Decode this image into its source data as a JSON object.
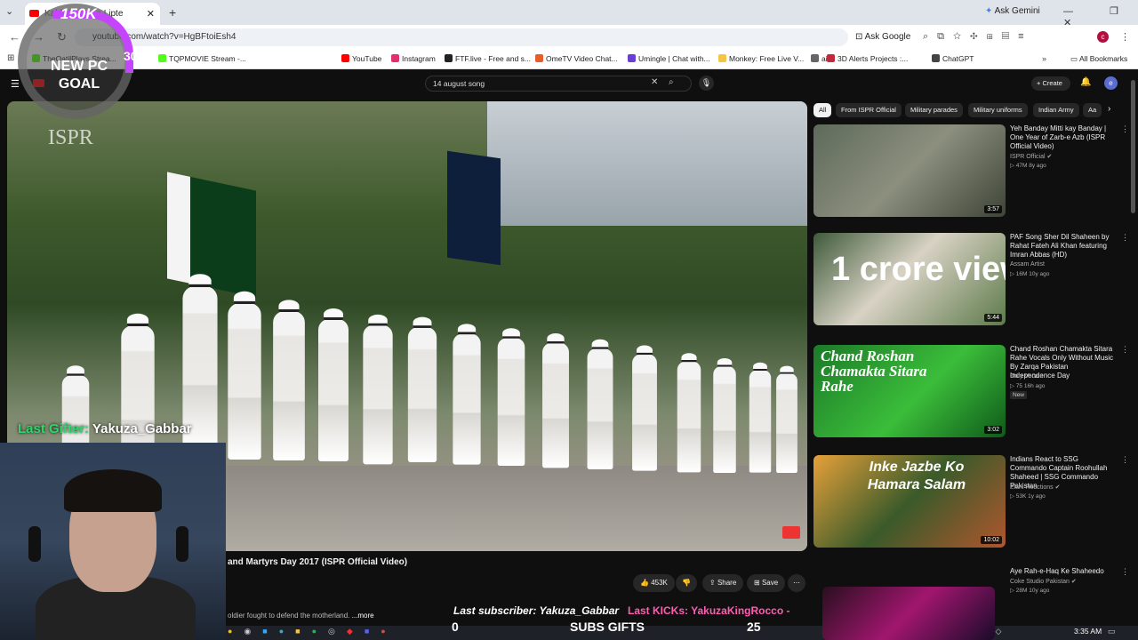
{
  "browser": {
    "tab_title": "Kabhi Tu Jaan Lipte",
    "new_tab": "+",
    "ask_gemini": "Ask Gemini",
    "window_controls": "— ❐ ✕",
    "url": "youtube.com/watch?v=HgBFtoiEsh4",
    "ask_google": "Ask Google",
    "profile_initial": "c",
    "bookmarks": [
      {
        "label": "TheQatilPlays Strea...",
        "color": "#53fc18"
      },
      {
        "label": "TQPMOVIE Stream -...",
        "color": "#53fc18"
      },
      {
        "label": "YouTube",
        "color": "#ff0000"
      },
      {
        "label": "Instagram",
        "color": "#e1306c"
      },
      {
        "label": "FTF.live - Free and s...",
        "color": "#222222"
      },
      {
        "label": "OmeTV Video Chat...",
        "color": "#e85c2a"
      },
      {
        "label": "Umingle | Chat with...",
        "color": "#6b3fd6"
      },
      {
        "label": "Monkey: Free Live V...",
        "color": "#f6c445"
      },
      {
        "label": "ai",
        "color": "#666666"
      },
      {
        "label": "3D Alerts Projects :...",
        "color": "#c02a3a"
      },
      {
        "label": "ChatGPT",
        "color": "#444444"
      }
    ],
    "all_bookmarks": "All Bookmarks"
  },
  "youtube": {
    "search_query": "14 august song",
    "create_label": "Create",
    "profile_initial": "e",
    "video_title": "and Martyrs Day 2017 (ISPR Official Video)",
    "watermark": "ISPR",
    "likes": "453K",
    "share": "Share",
    "save": "Save",
    "description": "oldier fought to defend the motherland.",
    "more": "...more",
    "chips": [
      "All",
      "From ISPR Official",
      "Military parades",
      "Military uniforms",
      "Indian Army",
      "Aa"
    ],
    "recommendations": [
      {
        "title": "Yeh Banday Mitti kay Banday | One Year of Zarb-e Azb (ISPR Official Video)",
        "channel": "ISPR Official ✔",
        "meta": "▷ 47M  8y ago",
        "duration": "3:57",
        "bg": "linear-gradient(135deg,#5e6a5a,#8c8f7e 50%,#3d4437)",
        "thumb_text": "",
        "is_new": false
      },
      {
        "title": "PAF Song Sher Dil Shaheen by Rahat Fateh Ali Khan featuring Imran Abbas (HD)",
        "channel": "Assam Artist",
        "meta": "▷ 16M  10y ago",
        "duration": "5:44",
        "bg": "linear-gradient(135deg,#3f5a3a,#d8d2c4 45%,#5d7a4a)",
        "thumb_text": "1 crore views",
        "is_new": false
      },
      {
        "title": "Chand Roshan Chamakta Sitara Rahe Vocals Only Without Music By Zarqa Pakistan Independence Day",
        "channel": "Only Vocals",
        "meta": "▷ 75  16h ago",
        "duration": "3:02",
        "bg": "linear-gradient(135deg,#1c7a28,#3bbd3a 55%,#0f5a1a)",
        "thumb_text": "Chand Roshan Chamakta Sitara Rahe",
        "is_new": true
      },
      {
        "title": "Indians React to SSG Commando Captain Roohullah Shaheed | SSG Commando Pakistan",
        "channel": "Elani Reactions ✔",
        "meta": "▷ 53K  1y ago",
        "duration": "10:02",
        "bg": "linear-gradient(135deg,#e6a13a,#3a5a2a 50%,#b0562d)",
        "thumb_text": "Inke Jazbe Ko Hamara Salam",
        "is_new": false
      },
      {
        "title": "Aye Rah-e-Haq Ke Shaheedo",
        "channel": "Coke Studio Pakistan ✔",
        "meta": "▷ 28M  10y ago",
        "duration": "",
        "bg": "linear-gradient(135deg,#2a0f1f,#a1166f 50%,#1a0b2a)",
        "thumb_text": "",
        "is_new": false
      }
    ],
    "new_badge": "New"
  },
  "stream_overlay": {
    "goal_top": "150K",
    "goal_mid": "30K",
    "goal_label": "NEW PC GOAL",
    "last_gifter_label": "Last Gifter:",
    "last_gifter_name": "Yakuza_Gabbar",
    "last_subscriber": "Last subscriber: Yakuza_Gabbar",
    "last_kicks": "Last KICKs: YakuzaKingRocco -",
    "count_left": "0",
    "subs_gifts": "SUBS GIFTS",
    "count_right": "25"
  },
  "taskbar": {
    "clock": "3:35 AM"
  }
}
